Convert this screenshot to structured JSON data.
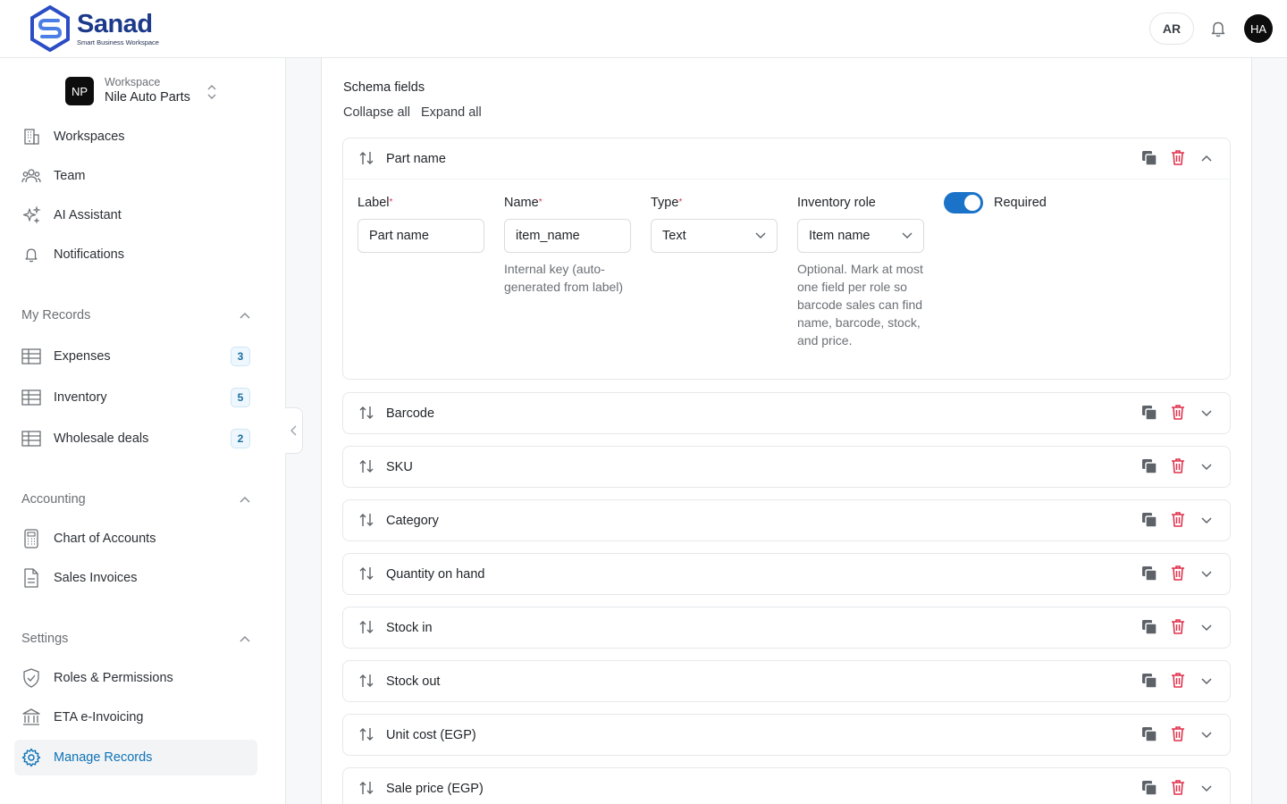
{
  "brand": {
    "name": "Sanad",
    "tagline": "Smart Business Workspace"
  },
  "header": {
    "lang": "AR",
    "user_initials": "HA"
  },
  "workspace": {
    "badge": "NP",
    "label": "Workspace",
    "name": "Nile Auto Parts"
  },
  "nav_main": [
    {
      "label": "Workspaces",
      "icon": "building-icon"
    },
    {
      "label": "Team",
      "icon": "team-icon"
    },
    {
      "label": "AI Assistant",
      "icon": "sparkles-icon"
    },
    {
      "label": "Notifications",
      "icon": "bell-icon"
    }
  ],
  "sections": {
    "my_records": {
      "title": "My Records",
      "items": [
        {
          "label": "Expenses",
          "count": "3"
        },
        {
          "label": "Inventory",
          "count": "5"
        },
        {
          "label": "Wholesale deals",
          "count": "2"
        }
      ]
    },
    "accounting": {
      "title": "Accounting",
      "items": [
        {
          "label": "Chart of Accounts"
        },
        {
          "label": "Sales Invoices"
        }
      ]
    },
    "settings": {
      "title": "Settings",
      "items": [
        {
          "label": "Roles & Permissions"
        },
        {
          "label": "ETA e-Invoicing"
        },
        {
          "label": "Manage Records"
        }
      ]
    }
  },
  "schema": {
    "title": "Schema fields",
    "collapse_all": "Collapse all",
    "expand_all": "Expand all",
    "expanded_field": {
      "name": "Part name",
      "label_title": "Label",
      "label_value": "Part name",
      "name_title": "Name",
      "name_value": "item_name",
      "name_help": "Internal key (auto-generated from label)",
      "type_title": "Type",
      "type_value": "Text",
      "role_title": "Inventory role",
      "role_value": "Item name",
      "role_help": "Optional. Mark at most one field per role so barcode sales can find name, barcode, stock, and price.",
      "required_label": "Required",
      "required": true
    },
    "fields": [
      {
        "name": "Barcode"
      },
      {
        "name": "SKU"
      },
      {
        "name": "Category"
      },
      {
        "name": "Quantity on hand"
      },
      {
        "name": "Stock in"
      },
      {
        "name": "Stock out"
      },
      {
        "name": "Unit cost (EGP)"
      },
      {
        "name": "Sale price (EGP)"
      }
    ]
  },
  "colors": {
    "accent": "#0f73b6",
    "danger": "#e0314b",
    "toggle": "#1a73c8"
  }
}
